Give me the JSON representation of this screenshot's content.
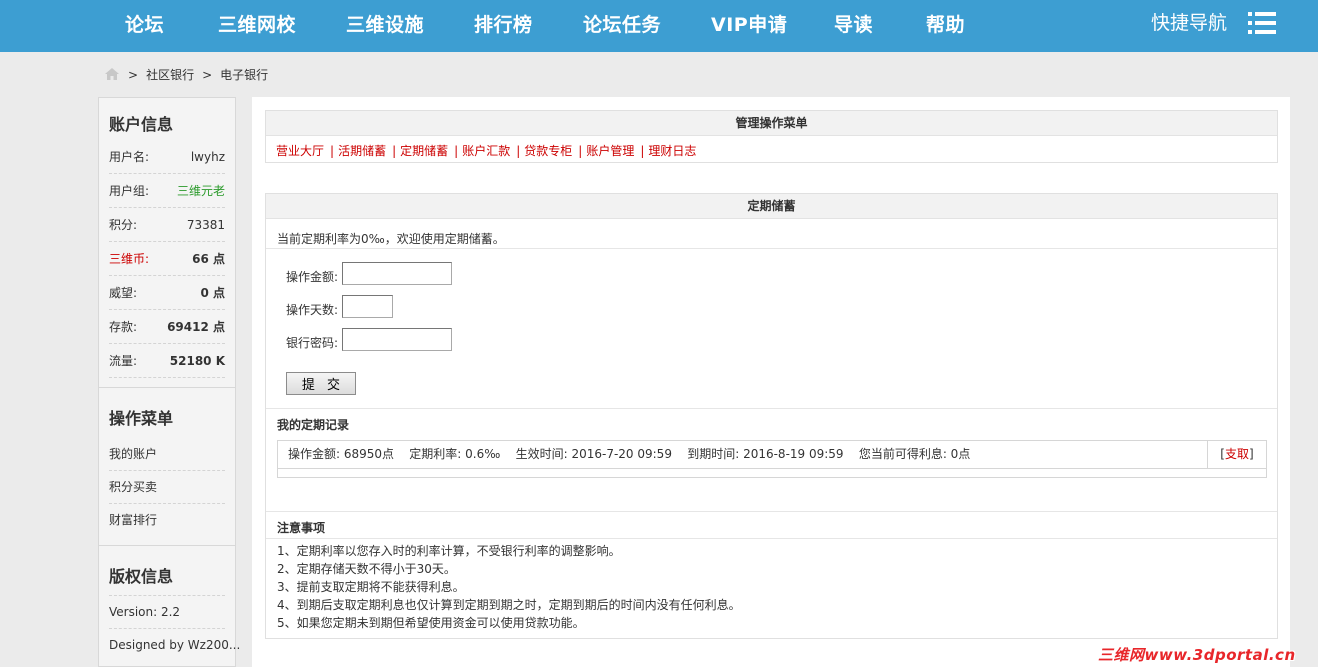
{
  "nav": {
    "items": [
      "论坛",
      "三维网校",
      "三维设施",
      "排行榜",
      "论坛任务",
      "VIP申请",
      "导读",
      "帮助"
    ],
    "quick_nav": "快捷导航"
  },
  "breadcrumb": {
    "sep": ">",
    "items": [
      "社区银行",
      "电子银行"
    ]
  },
  "sidebar": {
    "account_title": "账户信息",
    "account_rows": [
      {
        "k": "用户名:",
        "v": "lwyhz",
        "k_color": "#333333",
        "v_color": "#333333",
        "bold": false
      },
      {
        "k": "用户组:",
        "v": "三维元老",
        "k_color": "#333333",
        "v_color": "#2a9a2a",
        "bold": false
      },
      {
        "k": "积分:",
        "v": "73381",
        "k_color": "#333333",
        "v_color": "#333333",
        "bold": false
      },
      {
        "k": "三维币:",
        "v": "66 点",
        "k_color": "#cc0000",
        "v_color": "#333333",
        "bold": true
      },
      {
        "k": "威望:",
        "v": "0 点",
        "k_color": "#333333",
        "v_color": "#333333",
        "bold": true
      },
      {
        "k": "存款:",
        "v": "69412 点",
        "k_color": "#333333",
        "v_color": "#333333",
        "bold": true
      },
      {
        "k": "流量:",
        "v": "52180 K",
        "k_color": "#333333",
        "v_color": "#333333",
        "bold": true
      }
    ],
    "menu_title": "操作菜单",
    "menu_items": [
      "我的账户",
      "积分买卖",
      "财富排行"
    ],
    "copyright_title": "版权信息",
    "version": "Version: 2.2",
    "designed_by": "Designed by Wz200..."
  },
  "manage": {
    "title": "管理操作菜单",
    "links": [
      "营业大厅",
      "活期储蓄",
      "定期储蓄",
      "账户汇款",
      "贷款专柜",
      "账户管理",
      "理财日志"
    ]
  },
  "fixed": {
    "title": "定期储蓄",
    "intro": "当前定期利率为0‰，欢迎使用定期储蓄。",
    "label_amount": "操作金额:",
    "label_days": "操作天数:",
    "label_password": "银行密码:",
    "submit": "提 交",
    "records_title": "我的定期记录",
    "record": "操作金额: 68950点    定期利率: 0.6‰    生效时间: 2016-7-20 09:59    到期时间: 2016-8-19 09:59    您当前可得利息: 0点",
    "record_action_open": "[",
    "record_action": "支取",
    "record_action_close": "]",
    "notes_title": "注意事项",
    "notes": [
      "1、定期利率以您存入时的利率计算，不受银行利率的调整影响。",
      "2、定期存储天数不得小于30天。",
      "3、提前支取定期将不能获得利息。",
      "4、到期后支取定期利息也仅计算到定期到期之时，定期到期后的时间内没有任何利息。",
      "5、如果您定期未到期但希望使用资金可以使用贷款功能。"
    ]
  },
  "watermark": "三维网www.3dportal.cn",
  "colors": {
    "nav_bg": "#3d9ed2",
    "link_red": "#cc0000",
    "group_green": "#2a9a2a"
  }
}
